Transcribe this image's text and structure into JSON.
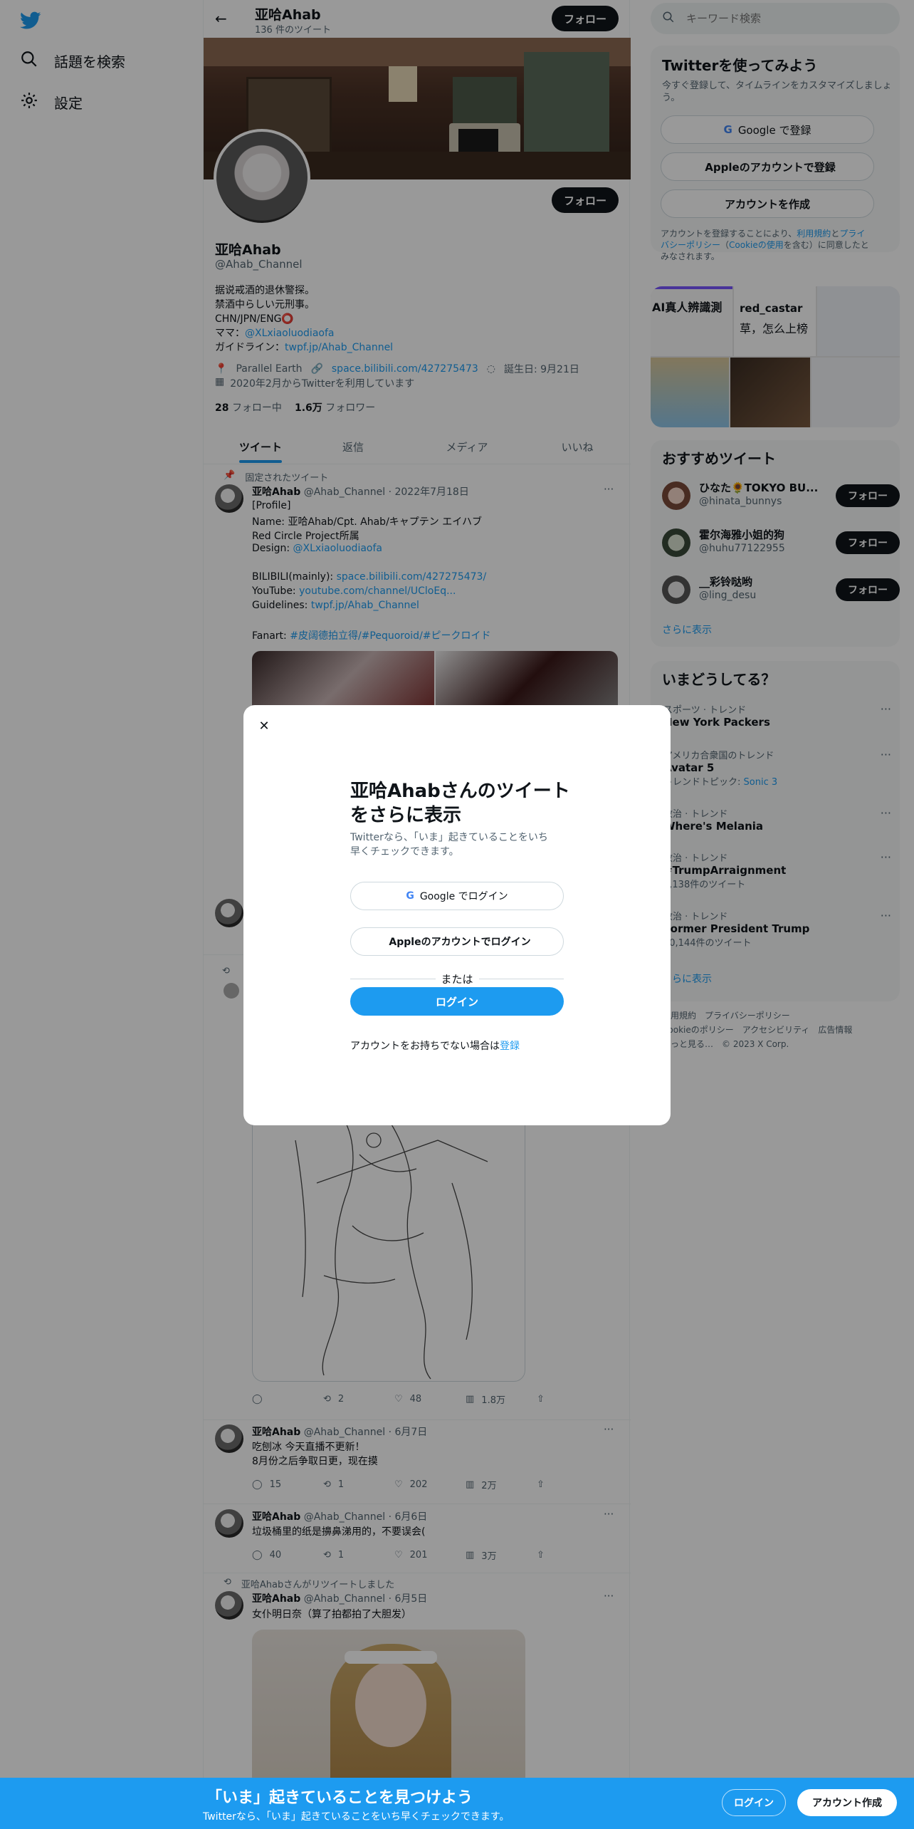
{
  "leftnav": {
    "explore_label": "話題を検索",
    "settings_label": "設定"
  },
  "header": {
    "name": "亚哈Ahab",
    "tweet_count": "136 件のツイート",
    "follow_label": "フォロー"
  },
  "profile": {
    "follow_label": "フォロー",
    "name": "亚哈Ahab",
    "handle": "@Ahab_Channel",
    "bio_line1": "据说戒酒的退休警探。",
    "bio_line2": "禁酒中らしい元刑事。",
    "bio_line3": "CHN/JPN/ENG",
    "bio_line3_mark": "⭕",
    "mama_prefix": "ママ：",
    "mama_link": "@XLxiaoluodiaofa",
    "guide_prefix": "ガイドライン：",
    "guide_link": "twpf.jp/Ahab_Channel",
    "location": "Parallel Earth",
    "website": "space.bilibili.com/427275473",
    "birthday": "誕生日: 9月21日",
    "joined": "2020年2月からTwitterを利用しています",
    "following_count": "28",
    "following_label": "フォロー中",
    "followers_count": "1.6万",
    "followers_label": "フォロワー"
  },
  "tabs": [
    "ツイート",
    "返信",
    "メディア",
    "いいね"
  ],
  "pinned_tweet": {
    "pinned_label": "固定されたツイート",
    "name": "亚哈Ahab",
    "meta": "@Ahab_Channel · 2022年7月18日",
    "line1": "[Profile]",
    "line2": "Name: 亚哈Ahab/Cpt. Ahab/キャプテン エイハブ",
    "line3": "Red Circle Project所属",
    "line4_prefix": "Design: ",
    "line4_link": "@XLxiaoluodiaofa",
    "line5_prefix": "BILIBILI(mainly): ",
    "line5_link": "space.bilibili.com/427275473/",
    "line6_prefix": "YouTube: ",
    "line6_link": "youtube.com/channel/UCloEq...",
    "line7_prefix": "Guidelines: ",
    "line7_link": "twpf.jp/Ahab_Channel",
    "line8_prefix": "Fanart: ",
    "line8_link": "#皮阔德拍立得/#Pequoroid/#ピークロイド"
  },
  "sketch_tweet_actions": {
    "replies": "",
    "retweets": "2",
    "likes": "48",
    "views": "1.8万"
  },
  "tweets": [
    {
      "name": "亚哈Ahab",
      "meta": "@Ahab_Channel · 6月7日",
      "line1": "吃刨冰 今天直播不更新！",
      "line2": "8月份之后争取日更，现在摸",
      "replies": "15",
      "retweets": "1",
      "likes": "202",
      "views": "2万"
    },
    {
      "name": "亚哈Ahab",
      "meta": "@Ahab_Channel · 6月6日",
      "line1": "垃圾桶里的纸是擤鼻涕用的，不要误会(",
      "replies": "40",
      "retweets": "1",
      "likes": "201",
      "views": "3万"
    },
    {
      "retweet_label": "亚哈Ahabさんがリツイートしました",
      "name": "亚哈Ahab",
      "meta": "@Ahab_Channel · 6月5日",
      "line1": "女仆明日奈（算了拍都拍了大胆发）"
    }
  ],
  "right": {
    "search_placeholder": "キーワード検索",
    "signup_title": "Twitterを使ってみよう",
    "signup_sub_line1": "今すぐ登録して、タイムラインをカスタマイズしましょ",
    "signup_sub_line2": "う。",
    "google_signup": "Google で登録",
    "apple_signup": "Appleのアカウントで登録",
    "create_account": "アカウントを作成",
    "terms_line1_a": "アカウントを登録することにより、",
    "terms_line1_link": "利用規約",
    "terms_line1_b": "と",
    "terms_line1_link2": "プライ",
    "terms_line2_link": "バシーポリシー",
    "terms_line2_b": "（",
    "terms_line2_link2": "Cookieの使用",
    "terms_line2_c": "を含む）に同意したと",
    "terms_line3": "みなされます。",
    "media_text1": "AI真人辨識測",
    "media_text2": "red_castar",
    "media_text3": "草，怎么上榜",
    "recommended_title": "おすすめツイート",
    "rec_users": [
      {
        "name": "ひなた🌻TOKYO BU...",
        "handle": "@hinata_bunnys",
        "follow": "フォロー"
      },
      {
        "name": "霍尔海雅小姐的狗",
        "handle": "@huhu77122955",
        "follow": "フォロー"
      },
      {
        "name": "__彩铃哒哟",
        "handle": "@ling_desu",
        "follow": "フォロー"
      }
    ],
    "show_more": "さらに表示",
    "trends_title": "いまどうしてる？",
    "trends": [
      {
        "cat": "スポーツ · トレンド",
        "name": "New York Packers"
      },
      {
        "cat": "アメリカ合衆国のトレンド",
        "name": "Avatar 5",
        "extra_prefix": "トレンドトピック: ",
        "extra_link": "Sonic 3"
      },
      {
        "cat": "政治 · トレンド",
        "name": "Where's Melania"
      },
      {
        "cat": "政治 · トレンド",
        "name": "#TrumpArraignment",
        "extra": "1,138件のツイート"
      },
      {
        "cat": "政治 · トレンド",
        "name": "Former President Trump",
        "extra": "50,144件のツイート"
      }
    ],
    "trends_more": "さらに表示",
    "footer_line1": "利用規約　プライバシーポリシー",
    "footer_line2": "Cookieのポリシー　アクセシビリティ　広告情報",
    "footer_line3": "もっと見る…　© 2023 X Corp."
  },
  "modal": {
    "close": "✕",
    "title_line1": "亚哈Ahabさんのツイート",
    "title_line2": "をさらに表示",
    "sub_line1": "Twitterなら、「いま」起きていることをいち",
    "sub_line2": "早くチェックできます。",
    "google_login": "Google でログイン",
    "apple_login": "Appleのアカウントでログイン",
    "or": "または",
    "login": "ログイン",
    "no_account": "アカウントをお持ちでない場合は",
    "register": "登録"
  },
  "bottombar": {
    "title": "「いま」起きていることを見つけよう",
    "sub": "Twitterなら、「いま」起きていることをいち早くチェックできます。",
    "login": "ログイン",
    "signup": "アカウント作成"
  },
  "colors": {
    "brand": "#1d9bf0",
    "text": "#0f1419",
    "muted": "#536471",
    "panel": "#f7f9f9"
  }
}
